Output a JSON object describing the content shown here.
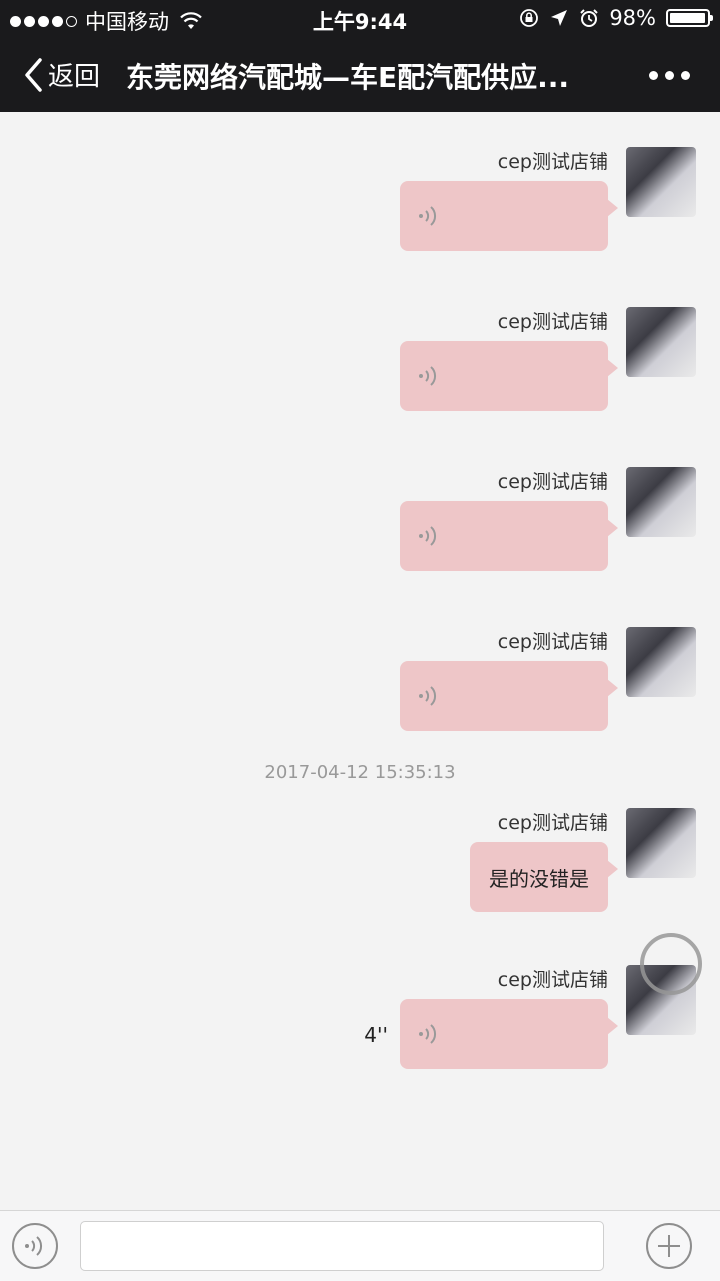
{
  "status_bar": {
    "carrier": "中国移动",
    "time": "上午9:44",
    "battery": "98%",
    "battery_level": 0.98
  },
  "nav": {
    "back_label": "返回",
    "title": "东莞网络汽配城—车E配汽配供应..."
  },
  "messages": [
    {
      "sender": "cep测试店铺",
      "type": "voice"
    },
    {
      "sender": "cep测试店铺",
      "type": "voice"
    },
    {
      "sender": "cep测试店铺",
      "type": "voice"
    },
    {
      "sender": "cep测试店铺",
      "type": "voice"
    },
    {
      "sender": "cep测试店铺",
      "type": "text",
      "text": "是的没错是"
    },
    {
      "sender": "cep测试店铺",
      "type": "voice",
      "duration": "4''"
    }
  ],
  "timestamp": "2017-04-12 15:35:13",
  "colors": {
    "bar_bg": "#1a1a1c",
    "chat_bg": "#f3f3f3",
    "bubble": "#eec6c8"
  },
  "icons": [
    "wifi-icon",
    "lock-rotation-icon",
    "location-arrow-icon",
    "alarm-icon",
    "battery-icon",
    "back-chevron-icon",
    "more-icon",
    "voice-icon",
    "plus-icon"
  ]
}
